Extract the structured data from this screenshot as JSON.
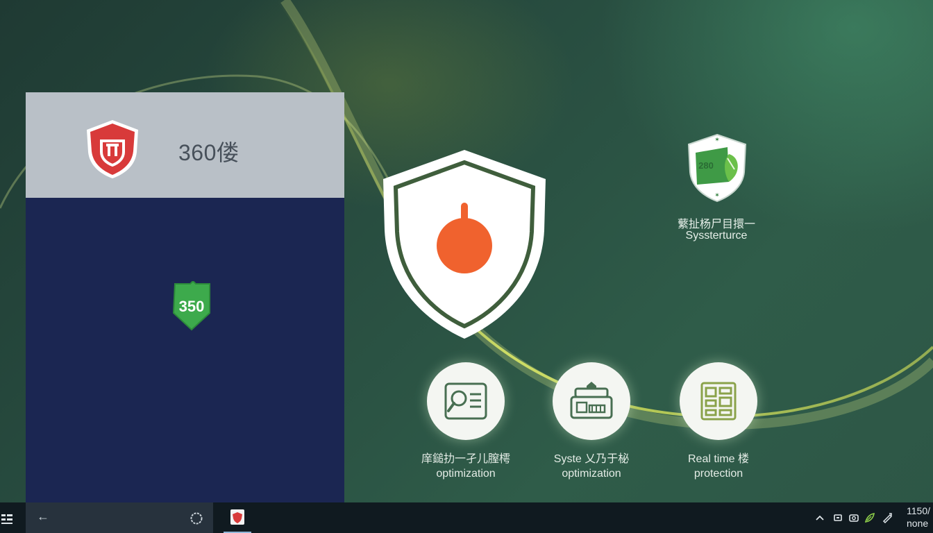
{
  "app": {
    "title": "360偻",
    "badge_text": "350"
  },
  "widget": {
    "badge_text": "280",
    "line1": "蘩扯杨尸目擐一",
    "line2": "Syssterturce"
  },
  "features": [
    {
      "label1": "庠鎚扐一孑儿膣樗",
      "label2": "optimization",
      "icon": "scan-icon"
    },
    {
      "label1": "Syste 乂乃于柲",
      "label2": "optimization",
      "icon": "system-icon"
    },
    {
      "label1": "Real time 楼",
      "label2": "protection",
      "icon": "protection-icon"
    }
  ],
  "taskbar": {
    "back_glyph": "←",
    "clock_line1": "1150/",
    "clock_line2": "none"
  },
  "colors": {
    "shield_red": "#d83a3a",
    "orange_dot": "#f0622e",
    "badge_green": "#3daa4c",
    "app_body": "#1b2652",
    "app_header": "#b9c0c7"
  }
}
